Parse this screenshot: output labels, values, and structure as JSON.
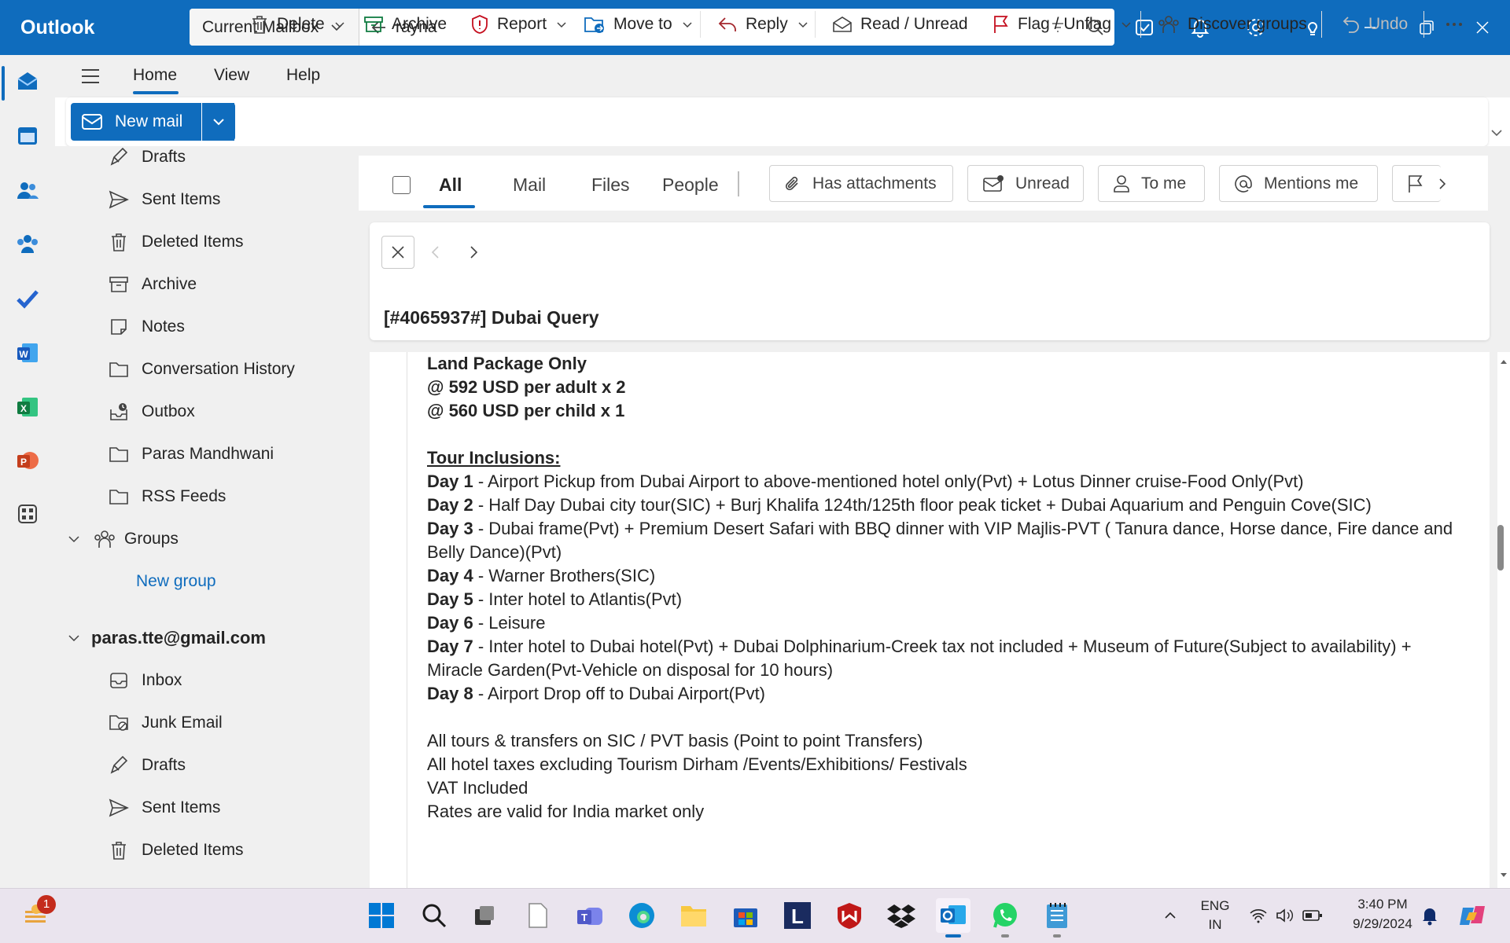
{
  "titlebar": {
    "app_name": "Outlook"
  },
  "search": {
    "scope": "Current Mailbox",
    "query": "rayna"
  },
  "menu": {
    "tabs": [
      "Home",
      "View",
      "Help"
    ]
  },
  "ribbon": {
    "new_mail": "New mail",
    "delete": "Delete",
    "archive": "Archive",
    "report": "Report",
    "move_to": "Move to",
    "reply": "Reply",
    "read_unread": "Read / Unread",
    "flag_unflag": "Flag / Unflag",
    "discover_groups": "Discover groups",
    "undo": "Undo"
  },
  "folders": {
    "drafts": "Drafts",
    "sent": "Sent Items",
    "deleted": "Deleted Items",
    "archive": "Archive",
    "notes": "Notes",
    "conv_history": "Conversation History",
    "outbox": "Outbox",
    "paras": "Paras Mandhwani",
    "rss": "RSS Feeds",
    "groups": "Groups",
    "new_group": "New group",
    "account": "paras.tte@gmail.com",
    "inbox": "Inbox",
    "junk": "Junk Email",
    "drafts2": "Drafts",
    "sent2": "Sent Items",
    "deleted2": "Deleted Items"
  },
  "filters": {
    "tabs": [
      "All",
      "Mail",
      "Files",
      "People"
    ],
    "chips": [
      "Has attachments",
      "Unread",
      "To me",
      "Mentions me"
    ]
  },
  "message": {
    "subject": "[#4065937#] Dubai Query",
    "package": "Land Package Only",
    "adult_rate": "@ 592 USD per adult x 2",
    "child_rate": "@ 560 USD per child x 1",
    "inclusions_title": "Tour Inclusions:",
    "days": [
      {
        "day": "Day 1",
        "text": " - Airport Pickup from Dubai Airport to above-mentioned hotel only(Pvt) + Lotus Dinner cruise-Food Only(Pvt)"
      },
      {
        "day": "Day 2",
        "text": " - Half Day Dubai city tour(SIC) + Burj Khalifa 124th/125th floor peak ticket + Dubai Aquarium and Penguin Cove(SIC)"
      },
      {
        "day": "Day 3",
        "text": " - Dubai frame(Pvt) + Premium Desert Safari with BBQ dinner with VIP Majlis-PVT ( Tanura dance, Horse dance, Fire dance and Belly Dance)(Pvt)"
      },
      {
        "day": "Day 4",
        "text": " - Warner Brothers(SIC)"
      },
      {
        "day": "Day 5",
        "text": " - Inter hotel to Atlantis(Pvt)"
      },
      {
        "day": "Day 6",
        "text": " - Leisure"
      },
      {
        "day": "Day 7",
        "text": " - Inter hotel to Dubai hotel(Pvt) + Dubai Dolphinarium-Creek tax not included + Museum of Future(Subject to availability) + Miracle Garden(Pvt-Vehicle on disposal for 10 hours)"
      },
      {
        "day": "Day 8",
        "text": " - Airport Drop off to Dubai Airport(Pvt)"
      }
    ],
    "notes": [
      "All tours & transfers on SIC / PVT basis (Point to point Transfers)",
      "All hotel taxes excluding Tourism Dirham /Events/Exhibitions/ Festivals",
      "VAT Included",
      "Rates are valid for India market only"
    ]
  },
  "taskbar": {
    "badge": "1",
    "lang": "ENG",
    "region": "IN",
    "time": "3:40 PM",
    "date": "9/29/2024"
  },
  "colors": {
    "accent": "#0f6cbd",
    "titlebar": "#0f6cbd"
  }
}
